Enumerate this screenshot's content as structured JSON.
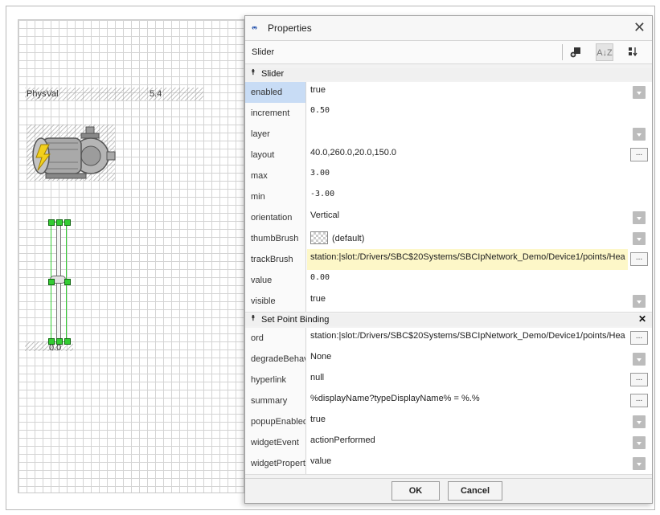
{
  "canvas": {
    "physval_label": "PhysVal",
    "physval_value": "5.4",
    "slider_value": "0.0"
  },
  "dialog": {
    "title": "Properties",
    "object_name": "Slider",
    "close_glyph": "✕",
    "toolbar": {
      "sort_label": "A↓Z",
      "icon_a": "add-icon",
      "icon_b": "sort-az-icon",
      "icon_c": "sort-icon"
    },
    "section_slider": "Slider",
    "section_binding": "Set Point Binding",
    "section_arrow": "⯭",
    "remove_glyph": "✕",
    "edit_button": "...",
    "ok_label": "OK",
    "cancel_label": "Cancel",
    "slider_props": [
      {
        "key": "enabled",
        "value": "true",
        "editor": "dropdown"
      },
      {
        "key": "increment",
        "value": "0.50",
        "editor": "text"
      },
      {
        "key": "layer",
        "value": "",
        "editor": "dropdown"
      },
      {
        "key": "layout",
        "value": "40.0,260.0,20.0,150.0",
        "editor": "button"
      },
      {
        "key": "max",
        "value": "3.00",
        "editor": "text"
      },
      {
        "key": "min",
        "value": "-3.00",
        "editor": "text"
      },
      {
        "key": "orientation",
        "value": "Vertical",
        "editor": "dropdown"
      },
      {
        "key": "thumbBrush",
        "value": "(default)",
        "editor": "dropdown"
      },
      {
        "key": "trackBrush",
        "value": "station:|slot:/Drivers/SBC$20Systems/SBCIpNetwork_Demo/Device1/points/Hea",
        "editor": "button"
      },
      {
        "key": "value",
        "value": "0.00",
        "editor": "text"
      },
      {
        "key": "visible",
        "value": "true",
        "editor": "dropdown"
      }
    ],
    "binding_props": [
      {
        "key": "ord",
        "value": "station:|slot:/Drivers/SBC$20Systems/SBCIpNetwork_Demo/Device1/points/Hea",
        "editor": "button"
      },
      {
        "key": "degradeBehavior",
        "value": "None",
        "editor": "dropdown"
      },
      {
        "key": "hyperlink",
        "value": "null",
        "editor": "button"
      },
      {
        "key": "summary",
        "value": "%displayName?typeDisplayName% = %.%",
        "editor": "button"
      },
      {
        "key": "popupEnabled",
        "value": "true",
        "editor": "dropdown"
      },
      {
        "key": "widgetEvent",
        "value": "actionPerformed",
        "editor": "dropdown"
      },
      {
        "key": "widgetProperty",
        "value": "value",
        "editor": "dropdown"
      }
    ]
  },
  "colors": {
    "selection": "#c8dcf5",
    "highlight": "#fdf7c8",
    "handle": "#33cc33",
    "accent": "#1a4aa8"
  }
}
